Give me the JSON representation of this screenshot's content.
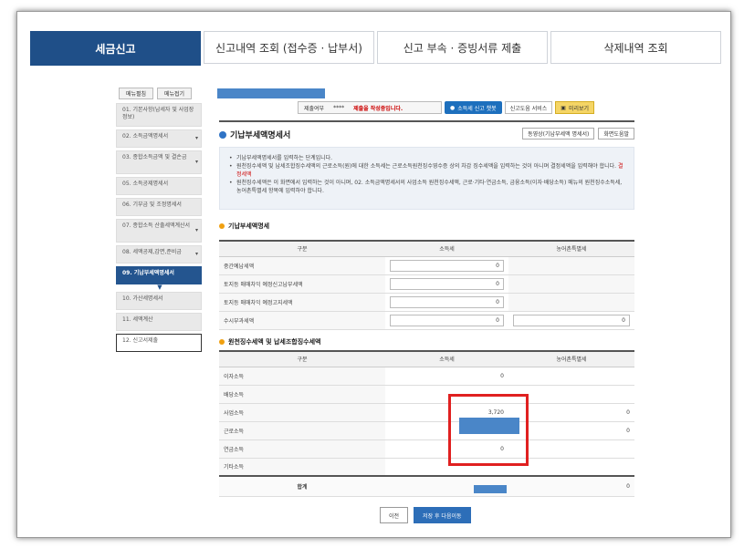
{
  "tabs": [
    {
      "label": "세금신고",
      "active": true
    },
    {
      "label": "신고내역 조회 (접수증 · 납부서)"
    },
    {
      "label": "신고 부속 · 증빙서류 제출"
    },
    {
      "label": "삭제내역 조회"
    }
  ],
  "sidebar": {
    "expand_label": "메뉴펼침",
    "collapse_label": "메뉴접기",
    "items": [
      {
        "label": "01. 기본사항(납세자 및 사업장정보)"
      },
      {
        "label": "02. 소득금액명세서"
      },
      {
        "label": "03. 종합소득금액 및 결손금"
      },
      {
        "label": "05. 소득공제명세서"
      },
      {
        "label": "06. 기부금 및 조정명세서"
      },
      {
        "label": "07. 종합소득 산출세액계산서"
      },
      {
        "label": "08. 세액공제,감면,준비금"
      },
      {
        "label": "09. 기납부세액명세서"
      },
      {
        "label": "10. 가산세명세서"
      },
      {
        "label": "11. 세액계산"
      },
      {
        "label": "12. 신고서제출"
      }
    ]
  },
  "statusbar": {
    "label": "제출여부",
    "stars": "****",
    "message": "제출을 작성중입니다.",
    "btn_blue": "소득세 신고 챗봇",
    "btn_help": "신고도움 서비스",
    "btn_preview": "미리보기"
  },
  "main": {
    "title": "기납부세액명세서",
    "btn_video": "동영상(기납부세액 명세서)",
    "btn_screen_help": "화면도움말",
    "info": [
      "기납부세액명세서를 입력하는 단계입니다.",
      "원천징수세액 및 납세조합징수세액의 근로소득(원)에 대한 소득세는 근로소득원천징수영수증 상의 차감 징수세액을 입력하는 것이 아니며 결정세액을 입력해야 합니다.",
      "원천징수세액은 이 화면에서 입력하는 것이 아니며, 02. 소득금액명세서의 사업소득 원천징수세액, 근로·기타·연금소득, 금융소득(이자·배당소득) 메뉴의 원천징수소득세, 농어촌특별세 항목에 입력하야 합니다."
    ],
    "info_red": "결정세액"
  },
  "section1": {
    "title": "기납부세액명세",
    "headers": [
      "구분",
      "소득세",
      "농어촌특별세"
    ],
    "rows": [
      {
        "label": "중간예납세액",
        "tax": "0",
        "rural": ""
      },
      {
        "label": "토지등 매매차익 예정신고납부세액",
        "tax": "0",
        "rural": ""
      },
      {
        "label": "토지등 매매차익 예정고지세액",
        "tax": "0",
        "rural": ""
      },
      {
        "label": "수시부과세액",
        "tax": "0",
        "rural": "0"
      }
    ]
  },
  "section2": {
    "title": "원천징수세액 및 납세조합징수세액",
    "headers": [
      "구분",
      "소득세",
      "농어촌특별세"
    ],
    "rows": [
      {
        "label": "이자소득",
        "tax": "0",
        "rural": ""
      },
      {
        "label": "배당소득",
        "tax": "",
        "rural": ""
      },
      {
        "label": "사업소득",
        "tax": "3,720",
        "rural": "0"
      },
      {
        "label": "근로소득",
        "tax": "",
        "rural": "0"
      },
      {
        "label": "연금소득",
        "tax": "0",
        "rural": ""
      },
      {
        "label": "기타소득",
        "tax": "",
        "rural": ""
      }
    ],
    "total_label": "합계",
    "total_rural": "0"
  },
  "buttons": {
    "prev": "이전",
    "next": "저장 후 다음이동"
  }
}
